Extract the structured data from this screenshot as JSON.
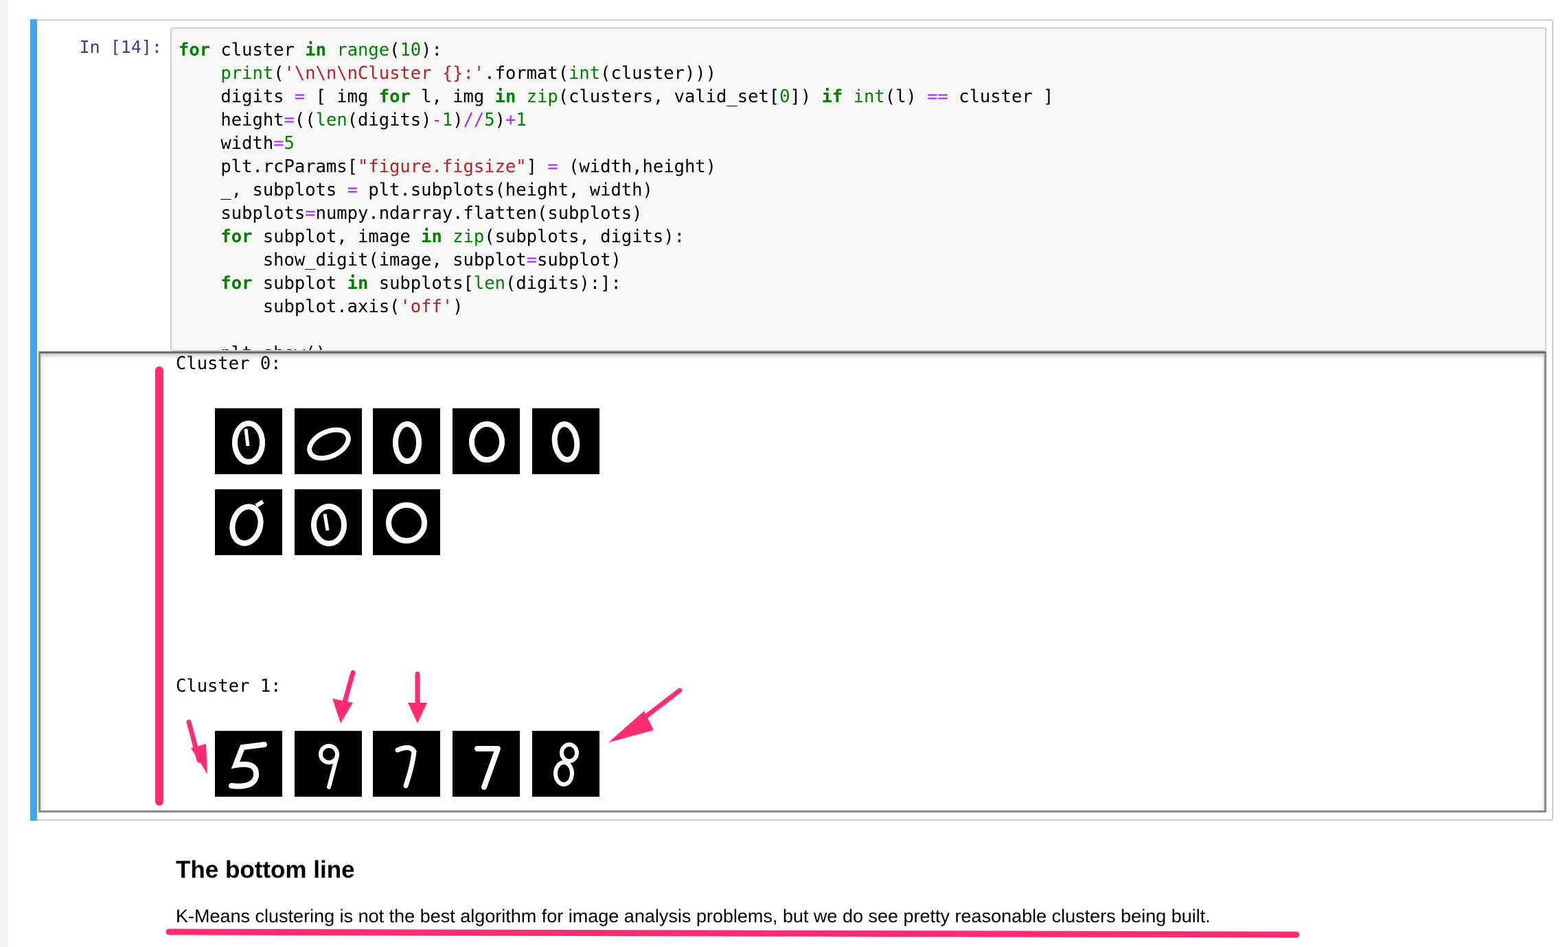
{
  "cell": {
    "prompt": "In [14]:",
    "code_lines": [
      "for cluster in range(10):",
      "    print('\\n\\n\\nCluster {}:'.format(int(cluster)))",
      "    digits = [ img for l, img in zip(clusters, valid_set[0]) if int(l) == cluster ]",
      "    height=((len(digits)-1)//5)+1",
      "    width=5",
      "    plt.rcParams[\"figure.figsize\"] = (width,height)",
      "    _, subplots = plt.subplots(height, width)",
      "    subplots=numpy.ndarray.flatten(subplots)",
      "    for subplot, image in zip(subplots, digits):",
      "        show_digit(image, subplot=subplot)",
      "    for subplot in subplots[len(digits):]:",
      "        subplot.axis('off')",
      "",
      "    plt.show()"
    ]
  },
  "output": {
    "clusters": [
      {
        "label": "Cluster 0:",
        "digits": [
          "0",
          "0",
          "0",
          "0",
          "0",
          "0",
          "0",
          "0"
        ]
      },
      {
        "label": "Cluster 1:",
        "digits": [
          "5",
          "9",
          "7",
          "7",
          "8"
        ]
      }
    ]
  },
  "markdown": {
    "heading": "The bottom line",
    "paragraph": "K-Means clustering is not the best algorithm for image analysis problems, but we do see pretty reasonable clusters being built."
  },
  "colors": {
    "cell_accent": "#42a5f5",
    "annotation": "#ff2d6f",
    "prompt": "#303f9f"
  }
}
